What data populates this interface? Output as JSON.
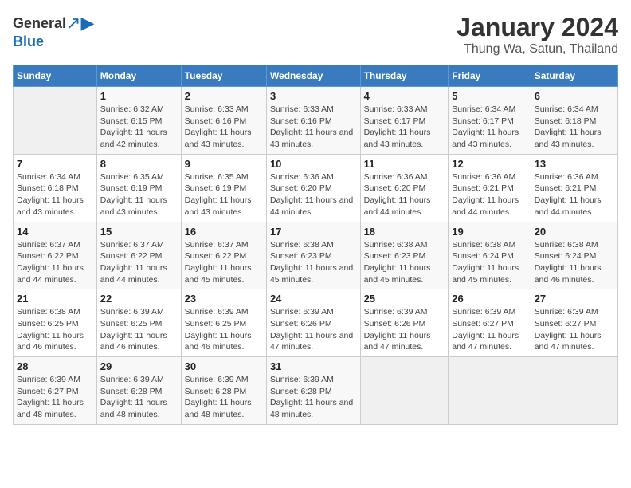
{
  "logo": {
    "general": "General",
    "blue": "Blue"
  },
  "title": "January 2024",
  "location": "Thung Wa, Satun, Thailand",
  "headers": [
    "Sunday",
    "Monday",
    "Tuesday",
    "Wednesday",
    "Thursday",
    "Friday",
    "Saturday"
  ],
  "weeks": [
    [
      {
        "day": "",
        "sunrise": "",
        "sunset": "",
        "daylight": ""
      },
      {
        "day": "1",
        "sunrise": "Sunrise: 6:32 AM",
        "sunset": "Sunset: 6:15 PM",
        "daylight": "Daylight: 11 hours and 42 minutes."
      },
      {
        "day": "2",
        "sunrise": "Sunrise: 6:33 AM",
        "sunset": "Sunset: 6:16 PM",
        "daylight": "Daylight: 11 hours and 43 minutes."
      },
      {
        "day": "3",
        "sunrise": "Sunrise: 6:33 AM",
        "sunset": "Sunset: 6:16 PM",
        "daylight": "Daylight: 11 hours and 43 minutes."
      },
      {
        "day": "4",
        "sunrise": "Sunrise: 6:33 AM",
        "sunset": "Sunset: 6:17 PM",
        "daylight": "Daylight: 11 hours and 43 minutes."
      },
      {
        "day": "5",
        "sunrise": "Sunrise: 6:34 AM",
        "sunset": "Sunset: 6:17 PM",
        "daylight": "Daylight: 11 hours and 43 minutes."
      },
      {
        "day": "6",
        "sunrise": "Sunrise: 6:34 AM",
        "sunset": "Sunset: 6:18 PM",
        "daylight": "Daylight: 11 hours and 43 minutes."
      }
    ],
    [
      {
        "day": "7",
        "sunrise": "Sunrise: 6:34 AM",
        "sunset": "Sunset: 6:18 PM",
        "daylight": "Daylight: 11 hours and 43 minutes."
      },
      {
        "day": "8",
        "sunrise": "Sunrise: 6:35 AM",
        "sunset": "Sunset: 6:19 PM",
        "daylight": "Daylight: 11 hours and 43 minutes."
      },
      {
        "day": "9",
        "sunrise": "Sunrise: 6:35 AM",
        "sunset": "Sunset: 6:19 PM",
        "daylight": "Daylight: 11 hours and 43 minutes."
      },
      {
        "day": "10",
        "sunrise": "Sunrise: 6:36 AM",
        "sunset": "Sunset: 6:20 PM",
        "daylight": "Daylight: 11 hours and 44 minutes."
      },
      {
        "day": "11",
        "sunrise": "Sunrise: 6:36 AM",
        "sunset": "Sunset: 6:20 PM",
        "daylight": "Daylight: 11 hours and 44 minutes."
      },
      {
        "day": "12",
        "sunrise": "Sunrise: 6:36 AM",
        "sunset": "Sunset: 6:21 PM",
        "daylight": "Daylight: 11 hours and 44 minutes."
      },
      {
        "day": "13",
        "sunrise": "Sunrise: 6:36 AM",
        "sunset": "Sunset: 6:21 PM",
        "daylight": "Daylight: 11 hours and 44 minutes."
      }
    ],
    [
      {
        "day": "14",
        "sunrise": "Sunrise: 6:37 AM",
        "sunset": "Sunset: 6:22 PM",
        "daylight": "Daylight: 11 hours and 44 minutes."
      },
      {
        "day": "15",
        "sunrise": "Sunrise: 6:37 AM",
        "sunset": "Sunset: 6:22 PM",
        "daylight": "Daylight: 11 hours and 44 minutes."
      },
      {
        "day": "16",
        "sunrise": "Sunrise: 6:37 AM",
        "sunset": "Sunset: 6:22 PM",
        "daylight": "Daylight: 11 hours and 45 minutes."
      },
      {
        "day": "17",
        "sunrise": "Sunrise: 6:38 AM",
        "sunset": "Sunset: 6:23 PM",
        "daylight": "Daylight: 11 hours and 45 minutes."
      },
      {
        "day": "18",
        "sunrise": "Sunrise: 6:38 AM",
        "sunset": "Sunset: 6:23 PM",
        "daylight": "Daylight: 11 hours and 45 minutes."
      },
      {
        "day": "19",
        "sunrise": "Sunrise: 6:38 AM",
        "sunset": "Sunset: 6:24 PM",
        "daylight": "Daylight: 11 hours and 45 minutes."
      },
      {
        "day": "20",
        "sunrise": "Sunrise: 6:38 AM",
        "sunset": "Sunset: 6:24 PM",
        "daylight": "Daylight: 11 hours and 46 minutes."
      }
    ],
    [
      {
        "day": "21",
        "sunrise": "Sunrise: 6:38 AM",
        "sunset": "Sunset: 6:25 PM",
        "daylight": "Daylight: 11 hours and 46 minutes."
      },
      {
        "day": "22",
        "sunrise": "Sunrise: 6:39 AM",
        "sunset": "Sunset: 6:25 PM",
        "daylight": "Daylight: 11 hours and 46 minutes."
      },
      {
        "day": "23",
        "sunrise": "Sunrise: 6:39 AM",
        "sunset": "Sunset: 6:25 PM",
        "daylight": "Daylight: 11 hours and 46 minutes."
      },
      {
        "day": "24",
        "sunrise": "Sunrise: 6:39 AM",
        "sunset": "Sunset: 6:26 PM",
        "daylight": "Daylight: 11 hours and 47 minutes."
      },
      {
        "day": "25",
        "sunrise": "Sunrise: 6:39 AM",
        "sunset": "Sunset: 6:26 PM",
        "daylight": "Daylight: 11 hours and 47 minutes."
      },
      {
        "day": "26",
        "sunrise": "Sunrise: 6:39 AM",
        "sunset": "Sunset: 6:27 PM",
        "daylight": "Daylight: 11 hours and 47 minutes."
      },
      {
        "day": "27",
        "sunrise": "Sunrise: 6:39 AM",
        "sunset": "Sunset: 6:27 PM",
        "daylight": "Daylight: 11 hours and 47 minutes."
      }
    ],
    [
      {
        "day": "28",
        "sunrise": "Sunrise: 6:39 AM",
        "sunset": "Sunset: 6:27 PM",
        "daylight": "Daylight: 11 hours and 48 minutes."
      },
      {
        "day": "29",
        "sunrise": "Sunrise: 6:39 AM",
        "sunset": "Sunset: 6:28 PM",
        "daylight": "Daylight: 11 hours and 48 minutes."
      },
      {
        "day": "30",
        "sunrise": "Sunrise: 6:39 AM",
        "sunset": "Sunset: 6:28 PM",
        "daylight": "Daylight: 11 hours and 48 minutes."
      },
      {
        "day": "31",
        "sunrise": "Sunrise: 6:39 AM",
        "sunset": "Sunset: 6:28 PM",
        "daylight": "Daylight: 11 hours and 48 minutes."
      },
      {
        "day": "",
        "sunrise": "",
        "sunset": "",
        "daylight": ""
      },
      {
        "day": "",
        "sunrise": "",
        "sunset": "",
        "daylight": ""
      },
      {
        "day": "",
        "sunrise": "",
        "sunset": "",
        "daylight": ""
      }
    ]
  ]
}
